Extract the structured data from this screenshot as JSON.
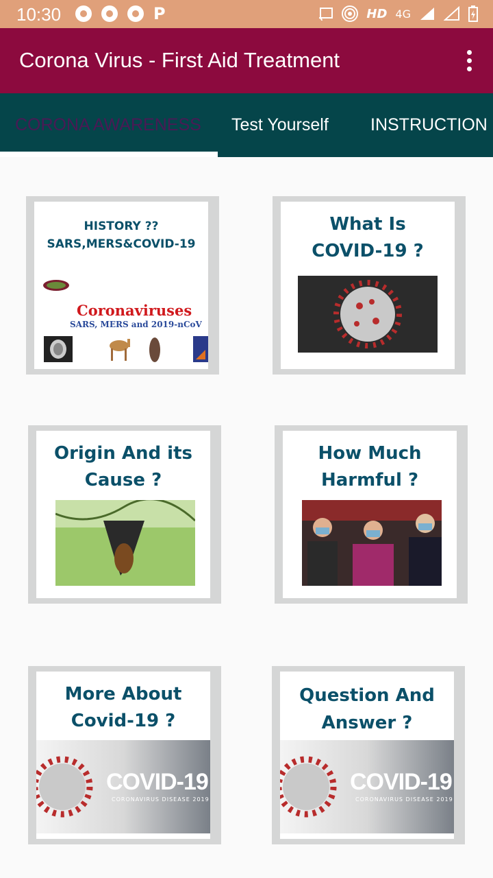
{
  "status": {
    "time": "10:30",
    "network": "HD",
    "signal": "4G"
  },
  "appbar": {
    "title": "Corona Virus - First Aid Treatment"
  },
  "tabs": [
    {
      "label": "CORONA AWARENESS"
    },
    {
      "label": "Test Yourself"
    },
    {
      "label": "INSTRUCTION"
    }
  ],
  "cards": [
    {
      "line1": "HISTORY ??",
      "line2": "SARS,MERS&COVID-19",
      "image_title": "Coronaviruses",
      "image_sub": "SARS, MERS and 2019-nCoV"
    },
    {
      "line1": "What Is",
      "line2": "COVID-19 ?"
    },
    {
      "line1": "Origin And its",
      "line2": "Cause ?"
    },
    {
      "line1": "How Much",
      "line2": "Harmful ?"
    },
    {
      "line1": "More About",
      "line2": "Covid-19 ?",
      "banner": "COVID-19",
      "banner_sub": "CORONAVIRUS DISEASE 2019"
    },
    {
      "line1": "Question And",
      "line2": "Answer ?",
      "banner": "COVID-19",
      "banner_sub": "CORONAVIRUS DISEASE 2019"
    }
  ]
}
